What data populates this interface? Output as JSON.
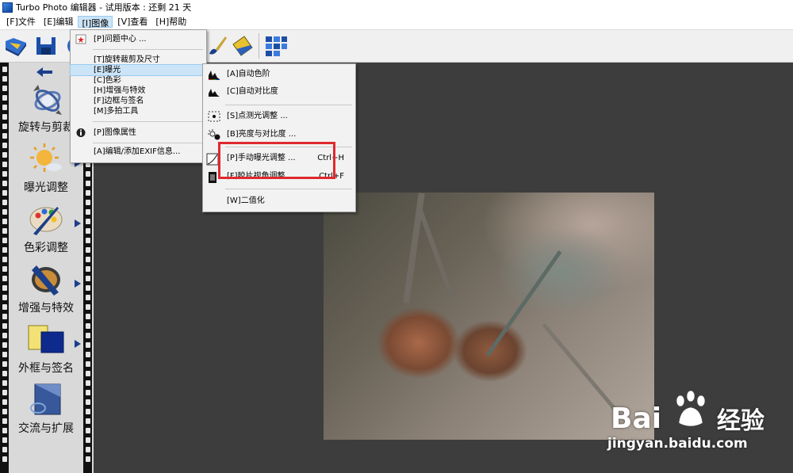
{
  "window": {
    "title": "Turbo Photo 编辑器 - 试用版本 : 还剩 21 天"
  },
  "menubar": {
    "items": [
      "[F]文件",
      "[E]编辑",
      "[I]图像",
      "[V]查看",
      "[H]帮助"
    ]
  },
  "sidebar": {
    "items": [
      {
        "label": "旋转与剪裁",
        "icon": "rotate-crop-icon"
      },
      {
        "label": "曝光调整",
        "icon": "exposure-sun-icon"
      },
      {
        "label": "色彩调整",
        "icon": "color-palette-icon"
      },
      {
        "label": "增强与特效",
        "icon": "lens-filter-icon"
      },
      {
        "label": "外框与签名",
        "icon": "frame-signature-icon"
      },
      {
        "label": "交流与扩展",
        "icon": "share-extend-icon"
      }
    ]
  },
  "image_menu": {
    "items": [
      {
        "label": "[P]问题中心 ...",
        "icon": "red-star-icon"
      },
      {
        "label": "[T]旋转裁剪及尺寸"
      },
      {
        "label": "[E]曝光",
        "highlighted": true
      },
      {
        "label": "[C]色彩"
      },
      {
        "label": "[H]增强与特效"
      },
      {
        "label": "[F]边框与签名"
      },
      {
        "label": "[M]多拍工具"
      },
      {
        "label": "[P]图像属性",
        "icon": "info-icon"
      },
      {
        "label": "[A]编辑/添加EXIF信息..."
      }
    ]
  },
  "exposure_submenu": {
    "items": [
      {
        "label": "[A]自动色阶",
        "shortcut": "",
        "icon": "histogram-color-icon"
      },
      {
        "label": "[C]自动对比度",
        "shortcut": "",
        "icon": "histogram-icon"
      },
      {
        "label": "[S]点测光调整 ...",
        "shortcut": "",
        "icon": "spot-meter-icon"
      },
      {
        "label": "[B]亮度与对比度 ...",
        "shortcut": "",
        "icon": "brightness-contrast-icon"
      },
      {
        "label": "[P]手动曝光调整 ...",
        "shortcut": "Ctrl+H",
        "icon": "curve-icon"
      },
      {
        "label": "[F]胶片视角调整 ...",
        "shortcut": "Ctrl+F",
        "icon": "film-icon"
      },
      {
        "label": "[W]二值化",
        "shortcut": "",
        "icon": ""
      }
    ]
  },
  "watermark": {
    "brand": "Bai",
    "brand_cn": "经验",
    "url": "jingyan.baidu.com"
  }
}
